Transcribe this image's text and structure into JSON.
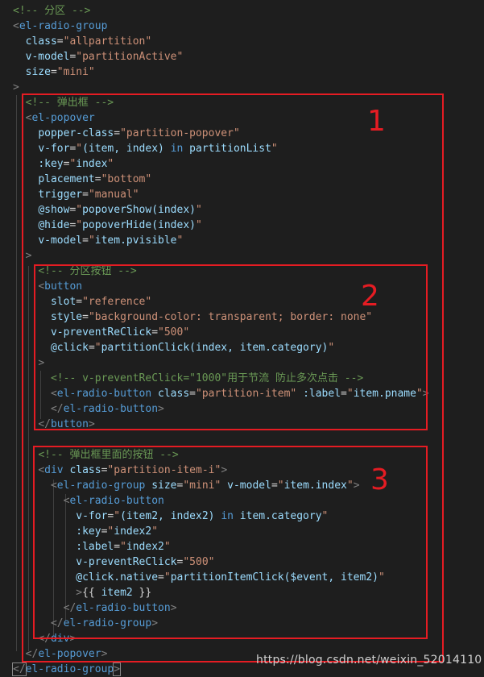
{
  "editor": {
    "theme_colors": {
      "background": "#1e1e1e",
      "comment": "#6a9955",
      "tag": "#569cd6",
      "attribute": "#9cdcfe",
      "string": "#ce9178",
      "keyword": "#569cd6",
      "text": "#d4d4d4",
      "punctuation": "#808080",
      "annotation": "#e51c23"
    },
    "lines": [
      [
        [
          "c",
          "<!-- 分区 -->"
        ]
      ],
      [
        [
          "p",
          "<"
        ],
        [
          "t",
          "el-radio-group"
        ]
      ],
      [
        [
          "s",
          "  "
        ],
        [
          "a",
          "class"
        ],
        [
          "x",
          "="
        ],
        [
          "s",
          "\"allpartition\""
        ]
      ],
      [
        [
          "s",
          "  "
        ],
        [
          "a",
          "v-model"
        ],
        [
          "x",
          "="
        ],
        [
          "s",
          "\"partitionActive\""
        ]
      ],
      [
        [
          "s",
          "  "
        ],
        [
          "a",
          "size"
        ],
        [
          "x",
          "="
        ],
        [
          "s",
          "\"mini\""
        ]
      ],
      [
        [
          "p",
          ">"
        ]
      ],
      [
        [
          "s",
          "  "
        ],
        [
          "c",
          "<!-- 弹出框 -->"
        ]
      ],
      [
        [
          "s",
          "  "
        ],
        [
          "p",
          "<"
        ],
        [
          "t",
          "el-popover"
        ]
      ],
      [
        [
          "s",
          "    "
        ],
        [
          "a",
          "popper-class"
        ],
        [
          "x",
          "="
        ],
        [
          "s",
          "\"partition-popover\""
        ]
      ],
      [
        [
          "s",
          "    "
        ],
        [
          "a",
          "v-for"
        ],
        [
          "x",
          "="
        ],
        [
          "s",
          "\""
        ],
        [
          "a",
          "(item, index) "
        ],
        [
          "k",
          "in"
        ],
        [
          "a",
          " partitionList"
        ],
        [
          "s",
          "\""
        ]
      ],
      [
        [
          "s",
          "    "
        ],
        [
          "a",
          ":key"
        ],
        [
          "x",
          "="
        ],
        [
          "s",
          "\""
        ],
        [
          "a",
          "index"
        ],
        [
          "s",
          "\""
        ]
      ],
      [
        [
          "s",
          "    "
        ],
        [
          "a",
          "placement"
        ],
        [
          "x",
          "="
        ],
        [
          "s",
          "\"bottom\""
        ]
      ],
      [
        [
          "s",
          "    "
        ],
        [
          "a",
          "trigger"
        ],
        [
          "x",
          "="
        ],
        [
          "s",
          "\"manual\""
        ]
      ],
      [
        [
          "s",
          "    "
        ],
        [
          "a",
          "@show"
        ],
        [
          "x",
          "="
        ],
        [
          "s",
          "\""
        ],
        [
          "a",
          "popoverShow(index)"
        ],
        [
          "s",
          "\""
        ]
      ],
      [
        [
          "s",
          "    "
        ],
        [
          "a",
          "@hide"
        ],
        [
          "x",
          "="
        ],
        [
          "s",
          "\""
        ],
        [
          "a",
          "popoverHide(index)"
        ],
        [
          "s",
          "\""
        ]
      ],
      [
        [
          "s",
          "    "
        ],
        [
          "a",
          "v-model"
        ],
        [
          "x",
          "="
        ],
        [
          "s",
          "\""
        ],
        [
          "a",
          "item.pvisible"
        ],
        [
          "s",
          "\""
        ]
      ],
      [
        [
          "s",
          "  "
        ],
        [
          "p",
          ">"
        ]
      ],
      [
        [
          "s",
          "    "
        ],
        [
          "c",
          "<!-- 分区按钮 -->"
        ]
      ],
      [
        [
          "s",
          "    "
        ],
        [
          "p",
          "<"
        ],
        [
          "t",
          "button"
        ]
      ],
      [
        [
          "s",
          "      "
        ],
        [
          "a",
          "slot"
        ],
        [
          "x",
          "="
        ],
        [
          "s",
          "\"reference\""
        ]
      ],
      [
        [
          "s",
          "      "
        ],
        [
          "a",
          "style"
        ],
        [
          "x",
          "="
        ],
        [
          "s",
          "\"background-color: transparent; border: none\""
        ]
      ],
      [
        [
          "s",
          "      "
        ],
        [
          "a",
          "v-preventReClick"
        ],
        [
          "x",
          "="
        ],
        [
          "s",
          "\"500\""
        ]
      ],
      [
        [
          "s",
          "      "
        ],
        [
          "a",
          "@click"
        ],
        [
          "x",
          "="
        ],
        [
          "s",
          "\""
        ],
        [
          "a",
          "partitionClick(index, item.category)"
        ],
        [
          "s",
          "\""
        ]
      ],
      [
        [
          "s",
          "    "
        ],
        [
          "p",
          ">"
        ]
      ],
      [
        [
          "s",
          "      "
        ],
        [
          "c",
          "<!-- v-preventReClick=\"1000\"用于节流 防止多次点击 -->"
        ]
      ],
      [
        [
          "s",
          "      "
        ],
        [
          "p",
          "<"
        ],
        [
          "t",
          "el-radio-button"
        ],
        [
          "x",
          " "
        ],
        [
          "a",
          "class"
        ],
        [
          "x",
          "="
        ],
        [
          "s",
          "\"partition-item\""
        ],
        [
          "x",
          " "
        ],
        [
          "a",
          ":label"
        ],
        [
          "x",
          "="
        ],
        [
          "s",
          "\""
        ],
        [
          "a",
          "item.pname"
        ],
        [
          "s",
          "\""
        ],
        [
          "p",
          ">"
        ]
      ],
      [
        [
          "s",
          "      "
        ],
        [
          "p",
          "</"
        ],
        [
          "t",
          "el-radio-button"
        ],
        [
          "p",
          ">"
        ]
      ],
      [
        [
          "s",
          "    "
        ],
        [
          "p",
          "</"
        ],
        [
          "t",
          "button"
        ],
        [
          "p",
          ">"
        ]
      ],
      [
        [
          "s",
          ""
        ]
      ],
      [
        [
          "s",
          "    "
        ],
        [
          "c",
          "<!-- 弹出框里面的按钮 -->"
        ]
      ],
      [
        [
          "s",
          "    "
        ],
        [
          "p",
          "<"
        ],
        [
          "t",
          "div"
        ],
        [
          "x",
          " "
        ],
        [
          "a",
          "class"
        ],
        [
          "x",
          "="
        ],
        [
          "s",
          "\"partition-item-i\""
        ],
        [
          "p",
          ">"
        ]
      ],
      [
        [
          "s",
          "      "
        ],
        [
          "p",
          "<"
        ],
        [
          "t",
          "el-radio-group"
        ],
        [
          "x",
          " "
        ],
        [
          "a",
          "size"
        ],
        [
          "x",
          "="
        ],
        [
          "s",
          "\"mini\""
        ],
        [
          "x",
          " "
        ],
        [
          "a",
          "v-model"
        ],
        [
          "x",
          "="
        ],
        [
          "s",
          "\""
        ],
        [
          "a",
          "item.index"
        ],
        [
          "s",
          "\""
        ],
        [
          "p",
          ">"
        ]
      ],
      [
        [
          "s",
          "        "
        ],
        [
          "p",
          "<"
        ],
        [
          "t",
          "el-radio-button"
        ]
      ],
      [
        [
          "s",
          "          "
        ],
        [
          "a",
          "v-for"
        ],
        [
          "x",
          "="
        ],
        [
          "s",
          "\""
        ],
        [
          "a",
          "(item2, index2) "
        ],
        [
          "k",
          "in"
        ],
        [
          "a",
          " item.category"
        ],
        [
          "s",
          "\""
        ]
      ],
      [
        [
          "s",
          "          "
        ],
        [
          "a",
          ":key"
        ],
        [
          "x",
          "="
        ],
        [
          "s",
          "\""
        ],
        [
          "a",
          "index2"
        ],
        [
          "s",
          "\""
        ]
      ],
      [
        [
          "s",
          "          "
        ],
        [
          "a",
          ":label"
        ],
        [
          "x",
          "="
        ],
        [
          "s",
          "\""
        ],
        [
          "a",
          "index2"
        ],
        [
          "s",
          "\""
        ]
      ],
      [
        [
          "s",
          "          "
        ],
        [
          "a",
          "v-preventReClick"
        ],
        [
          "x",
          "="
        ],
        [
          "s",
          "\"500\""
        ]
      ],
      [
        [
          "s",
          "          "
        ],
        [
          "a",
          "@click.native"
        ],
        [
          "x",
          "="
        ],
        [
          "s",
          "\""
        ],
        [
          "a",
          "partitionItemClick($event, item2)"
        ],
        [
          "s",
          "\""
        ]
      ],
      [
        [
          "s",
          "          "
        ],
        [
          "p",
          ">"
        ],
        [
          "x",
          "{{ "
        ],
        [
          "a",
          "item2"
        ],
        [
          "x",
          " }}"
        ]
      ],
      [
        [
          "s",
          "        "
        ],
        [
          "p",
          "</"
        ],
        [
          "t",
          "el-radio-button"
        ],
        [
          "p",
          ">"
        ]
      ],
      [
        [
          "s",
          "      "
        ],
        [
          "p",
          "</"
        ],
        [
          "t",
          "el-radio-group"
        ],
        [
          "p",
          ">"
        ]
      ],
      [
        [
          "s",
          "    "
        ],
        [
          "p",
          "</"
        ],
        [
          "t",
          "div"
        ],
        [
          "p",
          ">"
        ]
      ],
      [
        [
          "s",
          "  "
        ],
        [
          "p",
          "</"
        ],
        [
          "t",
          "el-popover"
        ],
        [
          "p",
          ">"
        ]
      ],
      [
        [
          "p",
          "</"
        ],
        [
          "t",
          "el-radio-group"
        ],
        [
          "p",
          ">"
        ]
      ]
    ]
  },
  "annotations": [
    {
      "label": "1"
    },
    {
      "label": "2"
    },
    {
      "label": "3"
    }
  ],
  "watermark": "https://blog.csdn.net/weixin_52014110"
}
